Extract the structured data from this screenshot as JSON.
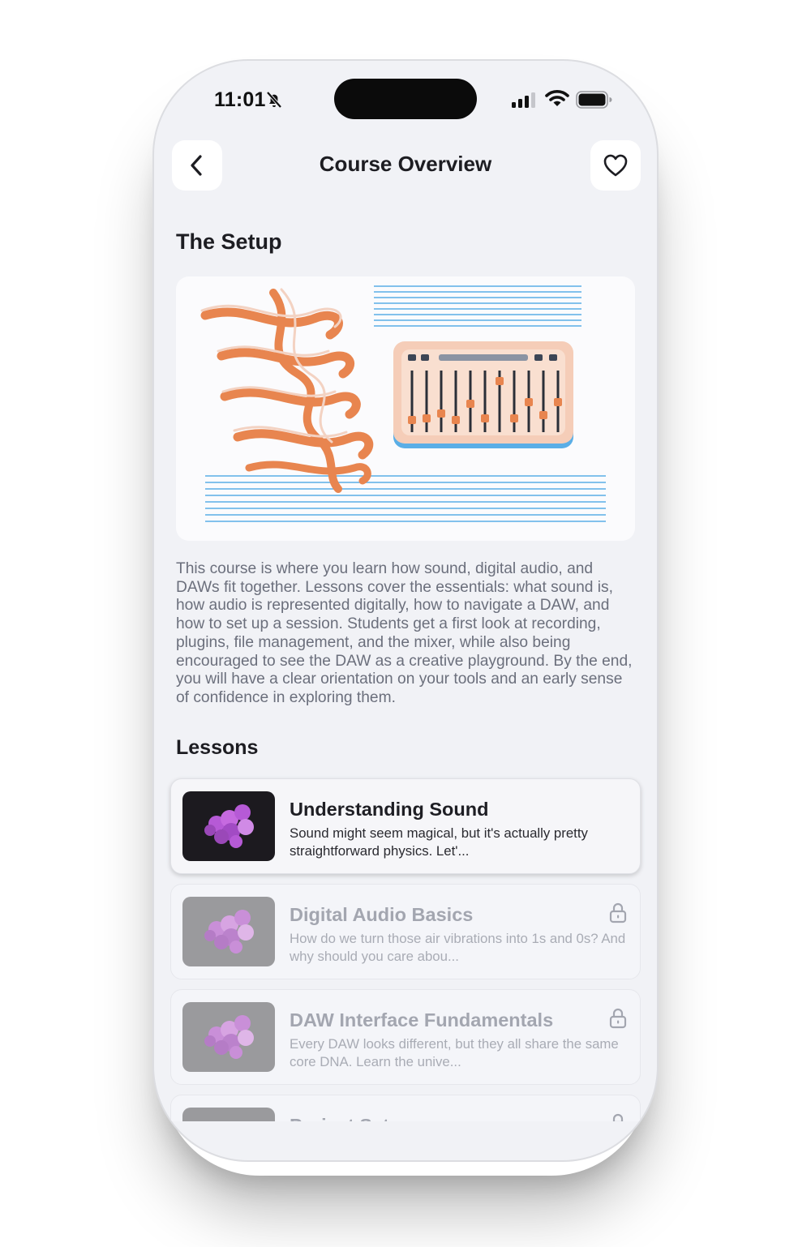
{
  "status_bar": {
    "time": "11:01"
  },
  "header": {
    "title": "Course Overview"
  },
  "course": {
    "title": "The Setup",
    "description": "This course is where you learn how sound, digital audio, and DAWs fit together. Lessons cover the essentials: what sound is, how audio is represented digitally, how to navigate a DAW, and how to set up a session. Students get a first look at recording, plugins, file management, and the mixer, while also being encouraged to see the DAW as a creative playground. By the end, you will have a clear orientation on your tools and an early sense of confidence in exploring them."
  },
  "lessons": {
    "heading": "Lessons",
    "items": [
      {
        "title": "Understanding Sound",
        "description": "Sound might seem magical, but it's actually pretty straightforward physics. Let'...",
        "locked": false
      },
      {
        "title": "Digital Audio Basics",
        "description": "How do we turn those air vibrations into 1s and 0s? And why should you care abou...",
        "locked": true
      },
      {
        "title": "DAW Interface Fundamentals",
        "description": "Every DAW looks different, but they all share the same core DNA. Learn the unive...",
        "locked": true
      },
      {
        "title": "Project Setup",
        "description": "",
        "locked": true
      }
    ]
  },
  "colors": {
    "accent": "#e8854f",
    "line_blue": "#5aaee6",
    "background": "#f1f2f6",
    "card": "#ffffff"
  },
  "icons": {
    "back": "chevron-left-icon",
    "favorite": "heart-icon",
    "lock": "lock-icon",
    "silent": "bell-slash-icon"
  }
}
